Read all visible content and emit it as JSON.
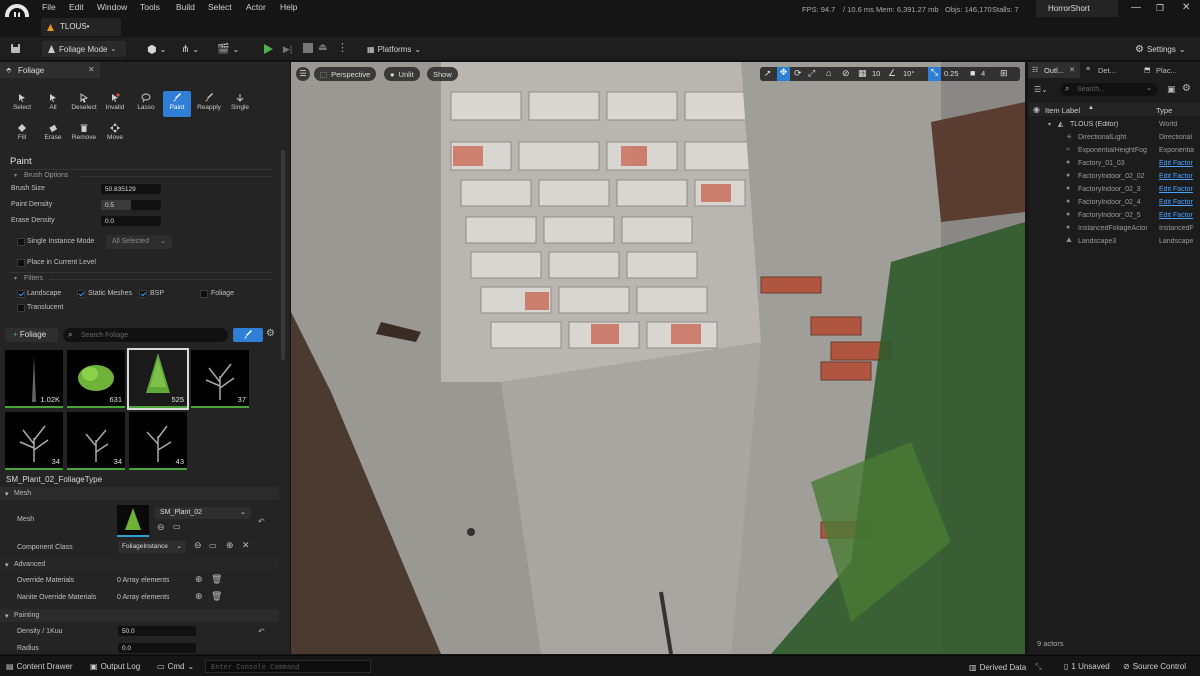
{
  "app": {
    "title": "HorrorShort",
    "document_tab": "TLOUS•"
  },
  "menu": [
    "File",
    "Edit",
    "Window",
    "Tools",
    "Build",
    "Select",
    "Actor",
    "Help"
  ],
  "stats": {
    "fps": "FPS: 94.7",
    "ms": "/ 10.6 ms",
    "mem": "Mem: 6,391.27 mb",
    "objs": "Objs: 146,170",
    "stalls": "Stalls: 7"
  },
  "toolbar": {
    "mode": "Foliage Mode",
    "platforms": "Platforms",
    "settings": "Settings"
  },
  "foliage_panel": {
    "tab": "Foliage",
    "tools_row1": [
      "Select",
      "All",
      "Deselect",
      "Invalid",
      "Lasso",
      "Paint",
      "Reapply",
      "Single"
    ],
    "tools_row2": [
      "Fill",
      "Erase",
      "Remove",
      "Move"
    ],
    "section": "Paint",
    "brush_options_header": "Brush Options",
    "brush_size_label": "Brush Size",
    "brush_size": "50.835129",
    "paint_density_label": "Paint Density",
    "paint_density": "0.5",
    "erase_density_label": "Erase Density",
    "erase_density": "0.0",
    "single_instance_label": "Single Instance Mode",
    "single_instance_value": "All Selected",
    "place_level_label": "Place in Current Level",
    "filters_header": "Filters",
    "filters": {
      "landscape": "Landscape",
      "static_meshes": "Static Meshes",
      "bsp": "BSP",
      "foliage": "Foliage",
      "translucent": "Translucent"
    },
    "add_foliage": "Foliage",
    "search_placeholder": "Search Foliage",
    "thumb_counts": [
      "1.02K",
      "631",
      "525",
      "37",
      "34",
      "34",
      "43"
    ],
    "selected_type": "SM_Plant_02_FoliageType",
    "mesh_header": "Mesh",
    "mesh_label": "Mesh",
    "mesh_value": "SM_Plant_02",
    "component_class_label": "Component Class",
    "component_class_value": "FoliageInstance",
    "advanced_header": "Advanced",
    "override_label": "Override Materials",
    "override_value": "0 Array elements",
    "nanite_label": "Nanite Override Materials",
    "nanite_value": "0 Array elements",
    "painting_header": "Painting",
    "density_label": "Density / 1Kuu",
    "density_value": "50.0",
    "radius_label": "Radius",
    "radius_value": "0.0"
  },
  "viewport": {
    "perspective": "Perspective",
    "unlit": "Unlit",
    "show": "Show",
    "grid": "10",
    "angle": "10°",
    "scale": "0.25",
    "camera": "4"
  },
  "outliner": {
    "tabs": [
      "Outl...",
      "Det...",
      "Plac..."
    ],
    "search_placeholder": "Search...",
    "col_label": "Item Label",
    "col_type": "Type",
    "rows": [
      {
        "label": "TLOUS (Editor)",
        "type": "World"
      },
      {
        "label": "DirectionalLight",
        "type": "Directional"
      },
      {
        "label": "ExponentialHeightFog",
        "type": "Exponentia"
      },
      {
        "label": "Factory_01_03",
        "type": "Edit Factor"
      },
      {
        "label": "FactoryIndoor_02_02",
        "type": "Edit Factor"
      },
      {
        "label": "FactoryIndoor_02_3",
        "type": "Edit Factor"
      },
      {
        "label": "FactoryIndoor_02_4",
        "type": "Edit Factor"
      },
      {
        "label": "FactoryIndoor_02_5",
        "type": "Edit Factor"
      },
      {
        "label": "InstancedFoliageActor",
        "type": "InstancedF"
      },
      {
        "label": "Landscape3",
        "type": "Landscape"
      }
    ],
    "actors_count": "9 actors"
  },
  "statusbar": {
    "content_drawer": "Content Drawer",
    "output_log": "Output Log",
    "cmd": "Cmd",
    "console_placeholder": "Enter Console Command",
    "derived_data": "Derived Data",
    "unsaved": "1 Unsaved",
    "source_control": "Source Control"
  },
  "colors": {
    "accent": "#2f7fd6",
    "link": "#4aa3ff",
    "play_green": "#4caf50",
    "panel": "#242424"
  }
}
